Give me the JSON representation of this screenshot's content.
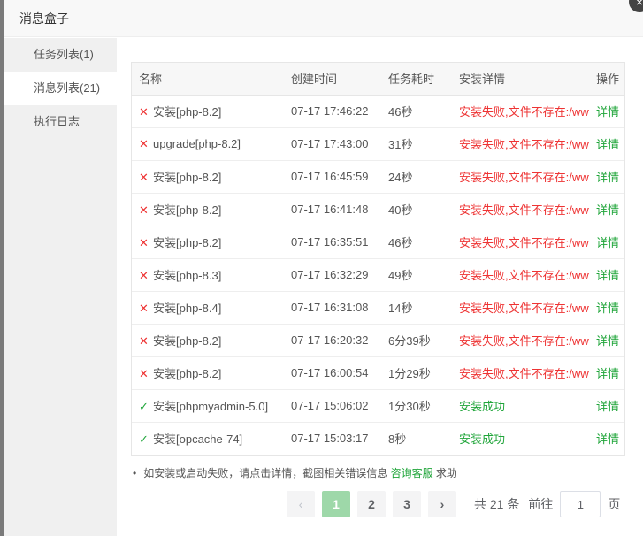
{
  "dialog": {
    "title": "消息盒子",
    "close_icon": "×"
  },
  "sidebar": {
    "items": [
      {
        "label": "任务列表(1)"
      },
      {
        "label": "消息列表(21)"
      },
      {
        "label": "执行日志"
      }
    ],
    "active_index": 1
  },
  "table": {
    "headers": [
      "名称",
      "创建时间",
      "任务耗时",
      "安装详情",
      "操作"
    ],
    "rows": [
      {
        "status": "fail",
        "name": "安装[php-8.2]",
        "time": "07-17 17:46:22",
        "duration": "46秒",
        "detail": "安装失败,文件不存在:/www",
        "op": "详情"
      },
      {
        "status": "fail",
        "name": "upgrade[php-8.2]",
        "time": "07-17 17:43:00",
        "duration": "31秒",
        "detail": "安装失败,文件不存在:/www",
        "op": "详情"
      },
      {
        "status": "fail",
        "name": "安装[php-8.2]",
        "time": "07-17 16:45:59",
        "duration": "24秒",
        "detail": "安装失败,文件不存在:/www",
        "op": "详情"
      },
      {
        "status": "fail",
        "name": "安装[php-8.2]",
        "time": "07-17 16:41:48",
        "duration": "40秒",
        "detail": "安装失败,文件不存在:/www",
        "op": "详情"
      },
      {
        "status": "fail",
        "name": "安装[php-8.2]",
        "time": "07-17 16:35:51",
        "duration": "46秒",
        "detail": "安装失败,文件不存在:/www",
        "op": "详情"
      },
      {
        "status": "fail",
        "name": "安装[php-8.3]",
        "time": "07-17 16:32:29",
        "duration": "49秒",
        "detail": "安装失败,文件不存在:/www",
        "op": "详情"
      },
      {
        "status": "fail",
        "name": "安装[php-8.4]",
        "time": "07-17 16:31:08",
        "duration": "14秒",
        "detail": "安装失败,文件不存在:/www",
        "op": "详情"
      },
      {
        "status": "fail",
        "name": "安装[php-8.2]",
        "time": "07-17 16:20:32",
        "duration": "6分39秒",
        "detail": "安装失败,文件不存在:/www",
        "op": "详情"
      },
      {
        "status": "fail",
        "name": "安装[php-8.2]",
        "time": "07-17 16:00:54",
        "duration": "1分29秒",
        "detail": "安装失败,文件不存在:/www",
        "op": "详情"
      },
      {
        "status": "ok",
        "name": "安装[phpmyadmin-5.0]",
        "time": "07-17 15:06:02",
        "duration": "1分30秒",
        "detail": "安装成功",
        "op": "详情"
      },
      {
        "status": "ok",
        "name": "安装[opcache-74]",
        "time": "07-17 15:03:17",
        "duration": "8秒",
        "detail": "安装成功",
        "op": "详情"
      }
    ]
  },
  "status_icons": {
    "fail": "✕",
    "ok": "✓"
  },
  "colors": {
    "success": "#20a53a",
    "error": "#e33333",
    "active_page": "#9ed8a9"
  },
  "note": {
    "text": "如安装或启动失败，请点击详情，截图相关错误信息",
    "link": "咨询客服",
    "suffix": "求助"
  },
  "pagination": {
    "prev_icon": "‹",
    "next_icon": "›",
    "pages": [
      "1",
      "2",
      "3"
    ],
    "current": "1",
    "total_text": "共 21 条",
    "goto_label": "前往",
    "goto_value": "1",
    "unit": "页"
  }
}
